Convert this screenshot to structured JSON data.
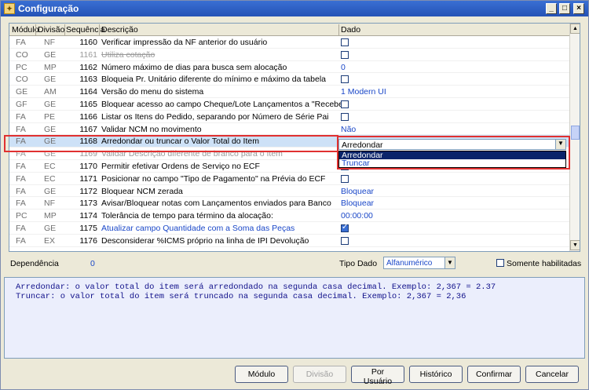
{
  "window": {
    "title": "Configuração"
  },
  "grid": {
    "headers": {
      "modulo": "Módulo",
      "divisao": "Divisão",
      "sequencia": "Sequência",
      "descricao": "Descrição",
      "dado": "Dado"
    },
    "rows": [
      {
        "mod": "FA",
        "div": "NF",
        "seq": "1160",
        "desc": "Verificar impressão da NF anterior do usuário",
        "type": "checkbox",
        "checked": false
      },
      {
        "mod": "CO",
        "div": "GE",
        "seq": "1161",
        "desc": "Utiliza cotação",
        "type": "checkbox",
        "checked": false,
        "disabled": true
      },
      {
        "mod": "PC",
        "div": "MP",
        "seq": "1162",
        "desc": "Número máximo de dias para busca sem alocação",
        "type": "text",
        "value": "0"
      },
      {
        "mod": "CO",
        "div": "GE",
        "seq": "1163",
        "desc": "Bloqueia Pr. Unitário diferente do mínimo e máximo da tabela",
        "type": "checkbox",
        "checked": false
      },
      {
        "mod": "GE",
        "div": "AM",
        "seq": "1164",
        "desc": "Versão do menu do sistema",
        "type": "text",
        "value": "1 Modern UI"
      },
      {
        "mod": "GF",
        "div": "GE",
        "seq": "1165",
        "desc": "Bloquear acesso ao campo Cheque/Lote Lançamentos a \"Receber\"",
        "type": "checkbox",
        "checked": false
      },
      {
        "mod": "FA",
        "div": "PE",
        "seq": "1166",
        "desc": "Listar os Itens do Pedido, separando por Número de Série Pai",
        "type": "checkbox",
        "checked": false
      },
      {
        "mod": "FA",
        "div": "GE",
        "seq": "1167",
        "desc": "Validar NCM no movimento",
        "type": "text",
        "value": "Não"
      },
      {
        "mod": "FA",
        "div": "GE",
        "seq": "1168",
        "desc": "Arredondar ou truncar o Valor Total do Item",
        "type": "combo",
        "selected": true
      },
      {
        "mod": "FA",
        "div": "GE",
        "seq": "1169",
        "desc": "Validar Descrição diferente de branco para o Item",
        "type": "none"
      },
      {
        "mod": "FA",
        "div": "EC",
        "seq": "1170",
        "desc": "Permitir efetivar Ordens de Serviço no ECF",
        "type": "checkbox",
        "checked": false
      },
      {
        "mod": "FA",
        "div": "EC",
        "seq": "1171",
        "desc": "Posicionar no campo \"Tipo de Pagamento\" na Prévia do ECF",
        "type": "checkbox",
        "checked": false
      },
      {
        "mod": "FA",
        "div": "GE",
        "seq": "1172",
        "desc": "Bloquear NCM zerada",
        "type": "text",
        "value": "Bloquear"
      },
      {
        "mod": "FA",
        "div": "NF",
        "seq": "1173",
        "desc": "Avisar/Bloquear notas com Lançamentos enviados para Banco",
        "type": "text",
        "value": "Bloquear"
      },
      {
        "mod": "PC",
        "div": "MP",
        "seq": "1174",
        "desc": "Tolerância de tempo para término da alocação:",
        "type": "text",
        "value": "00:00:00"
      },
      {
        "mod": "FA",
        "div": "GE",
        "seq": "1175",
        "desc": "Atualizar campo Quantidade com a Soma das Peças",
        "type": "checkbox",
        "checked": true,
        "blue": true
      },
      {
        "mod": "FA",
        "div": "EX",
        "seq": "1176",
        "desc": "Desconsiderar %ICMS próprio na linha de IPI Devolução",
        "type": "checkbox",
        "checked": false
      }
    ]
  },
  "combo": {
    "value": "Arredondar",
    "options": [
      "Arredondar",
      "Truncar"
    ]
  },
  "footer": {
    "dependencia_label": "Dependência",
    "dependencia_value": "0",
    "tipo_dado_label": "Tipo Dado",
    "tipo_dado_value": "Alfanumérico",
    "somente_label": "Somente habilitadas"
  },
  "memo": {
    "line1": "Arredondar: o valor total do item será arredondado na segunda casa decimal. Exemplo: 2,367 = 2.37",
    "line2": "Truncar: o valor total do item será truncado na segunda casa decimal. Exemplo: 2,367 = 2,36"
  },
  "buttons": {
    "modulo": "Módulo",
    "divisao": "Divisão",
    "por_usuario": "Por Usuário",
    "historico": "Histórico",
    "confirmar": "Confirmar",
    "cancelar": "Cancelar"
  },
  "colors": {
    "accent": "#1a47c8",
    "highlight": "#e03030",
    "selection": "#0a246a"
  }
}
